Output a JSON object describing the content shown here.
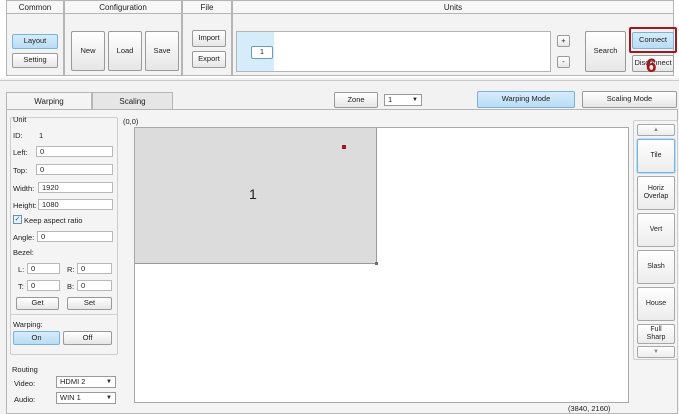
{
  "ribbon": {
    "common": {
      "title": "Common",
      "layout": "Layout",
      "setting": "Setting"
    },
    "configuration": {
      "title": "Configuration",
      "new": "New",
      "load": "Load",
      "save": "Save"
    },
    "file": {
      "title": "File",
      "import": "Import",
      "export": "Export"
    },
    "units": {
      "title": "Units",
      "unit_chip": "1",
      "plus": "+",
      "minus": "-",
      "search": "Search"
    },
    "connect": "Connect",
    "disconnect": "Disconnect",
    "callout": "6"
  },
  "tabs": {
    "warping": "Warping",
    "scaling": "Scaling"
  },
  "zone": {
    "label": "Zone",
    "value": "1"
  },
  "modes": {
    "warping": "Warping Mode",
    "scaling": "Scaling Mode"
  },
  "unit_panel": {
    "title": "Unit",
    "id_label": "ID:",
    "id_value": "1",
    "left_label": "Left:",
    "left_value": "0",
    "top_label": "Top:",
    "top_value": "0",
    "width_label": "Width:",
    "width_value": "1920",
    "height_label": "Height:",
    "height_value": "1080",
    "keep_aspect": "Keep aspect ratio",
    "angle_label": "Angle:",
    "angle_value": "0",
    "bezel_label": "Bezel:",
    "bezel_l_label": "L:",
    "bezel_l": "0",
    "bezel_r_label": "R:",
    "bezel_r": "0",
    "bezel_t_label": "T:",
    "bezel_t": "0",
    "bezel_b_label": "B:",
    "bezel_b": "0",
    "get": "Get",
    "set": "Set",
    "warping_title": "Warping:",
    "on": "On",
    "off": "Off",
    "routing_title": "Routing",
    "video_label": "Video:",
    "video_value": "HDMI 2",
    "audio_label": "Audio:",
    "audio_value": "WIN 1"
  },
  "canvas": {
    "origin": "(0,0)",
    "extent": "(3840, 2160)",
    "unit_label": "1"
  },
  "layout_tools": {
    "up": "▲",
    "tile": "Tile",
    "horiz": "Horiz Overlap",
    "vert": "Vert",
    "slash": "Slash",
    "house": "House",
    "full": "Full Sharp",
    "down": "▼"
  },
  "colors": {
    "accent_blue": "#b9dcf4",
    "callout_red": "#a3161a",
    "unit_fill": "#dcdcdc"
  }
}
